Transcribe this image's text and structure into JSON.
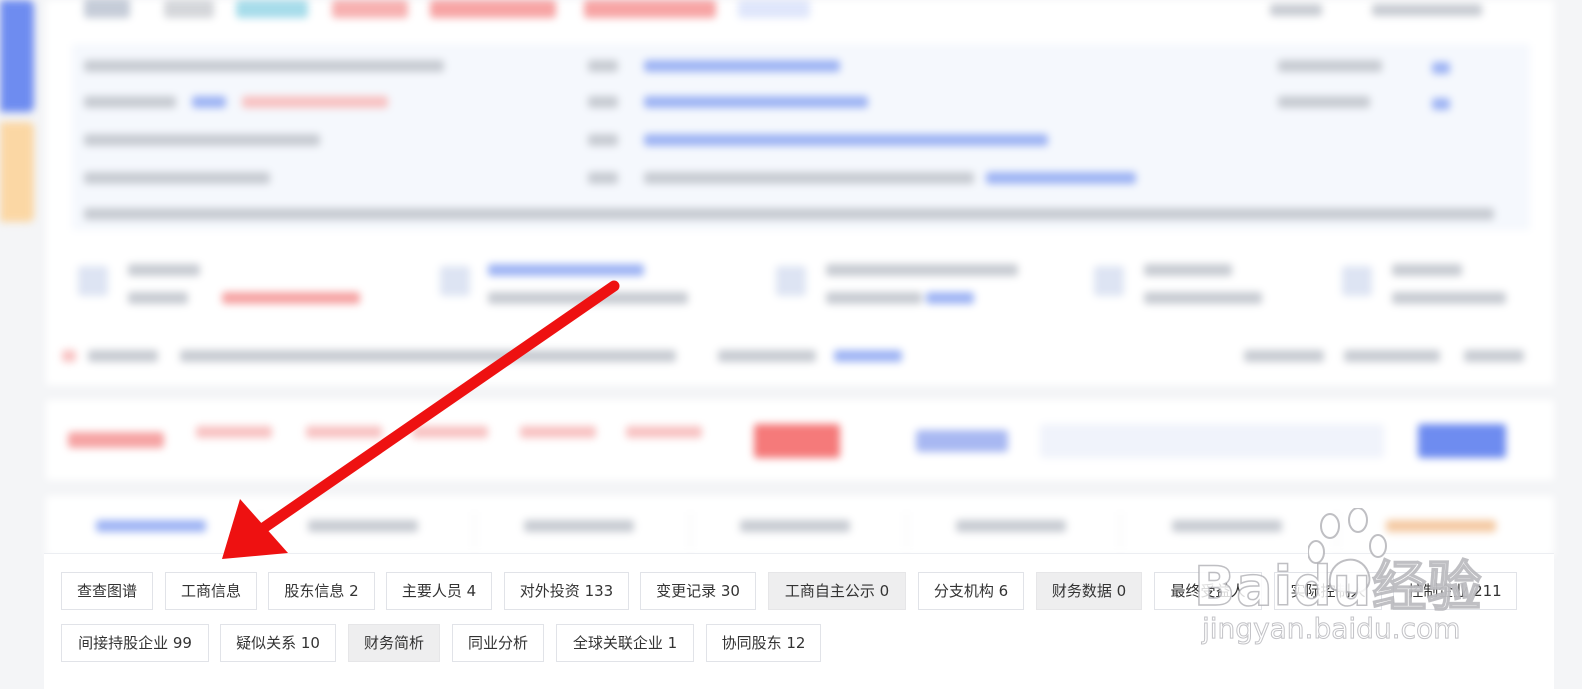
{
  "tags_row1": [
    {
      "label": "查查图谱",
      "highlight": false
    },
    {
      "label": "工商信息",
      "highlight": false
    },
    {
      "label": "股东信息 2",
      "highlight": false
    },
    {
      "label": "主要人员 4",
      "highlight": false
    },
    {
      "label": "对外投资 133",
      "highlight": false
    },
    {
      "label": "变更记录 30",
      "highlight": false
    },
    {
      "label": "工商自主公示 0",
      "highlight": true
    },
    {
      "label": "分支机构 6",
      "highlight": false
    },
    {
      "label": "财务数据 0",
      "highlight": true
    },
    {
      "label": "最终受益人",
      "highlight": false
    },
    {
      "label": "实际控制人",
      "highlight": false
    },
    {
      "label": "控制企业 211",
      "highlight": false
    }
  ],
  "tags_row2": [
    {
      "label": "间接持股企业 99",
      "highlight": false
    },
    {
      "label": "疑似关系 10",
      "highlight": false
    },
    {
      "label": "财务简析",
      "highlight": true
    },
    {
      "label": "同业分析",
      "highlight": false
    },
    {
      "label": "全球关联企业 1",
      "highlight": false
    },
    {
      "label": "协同股东 12",
      "highlight": false
    }
  ],
  "watermark": {
    "logo": "Baidu经验",
    "url": "jingyan.baidu.com"
  },
  "colors": {
    "arrow": "#ee1111",
    "highlight_tag_bg": "#eeeeef",
    "tag_border": "#e1e3e8",
    "accent_blue": "#6e8cf0"
  }
}
